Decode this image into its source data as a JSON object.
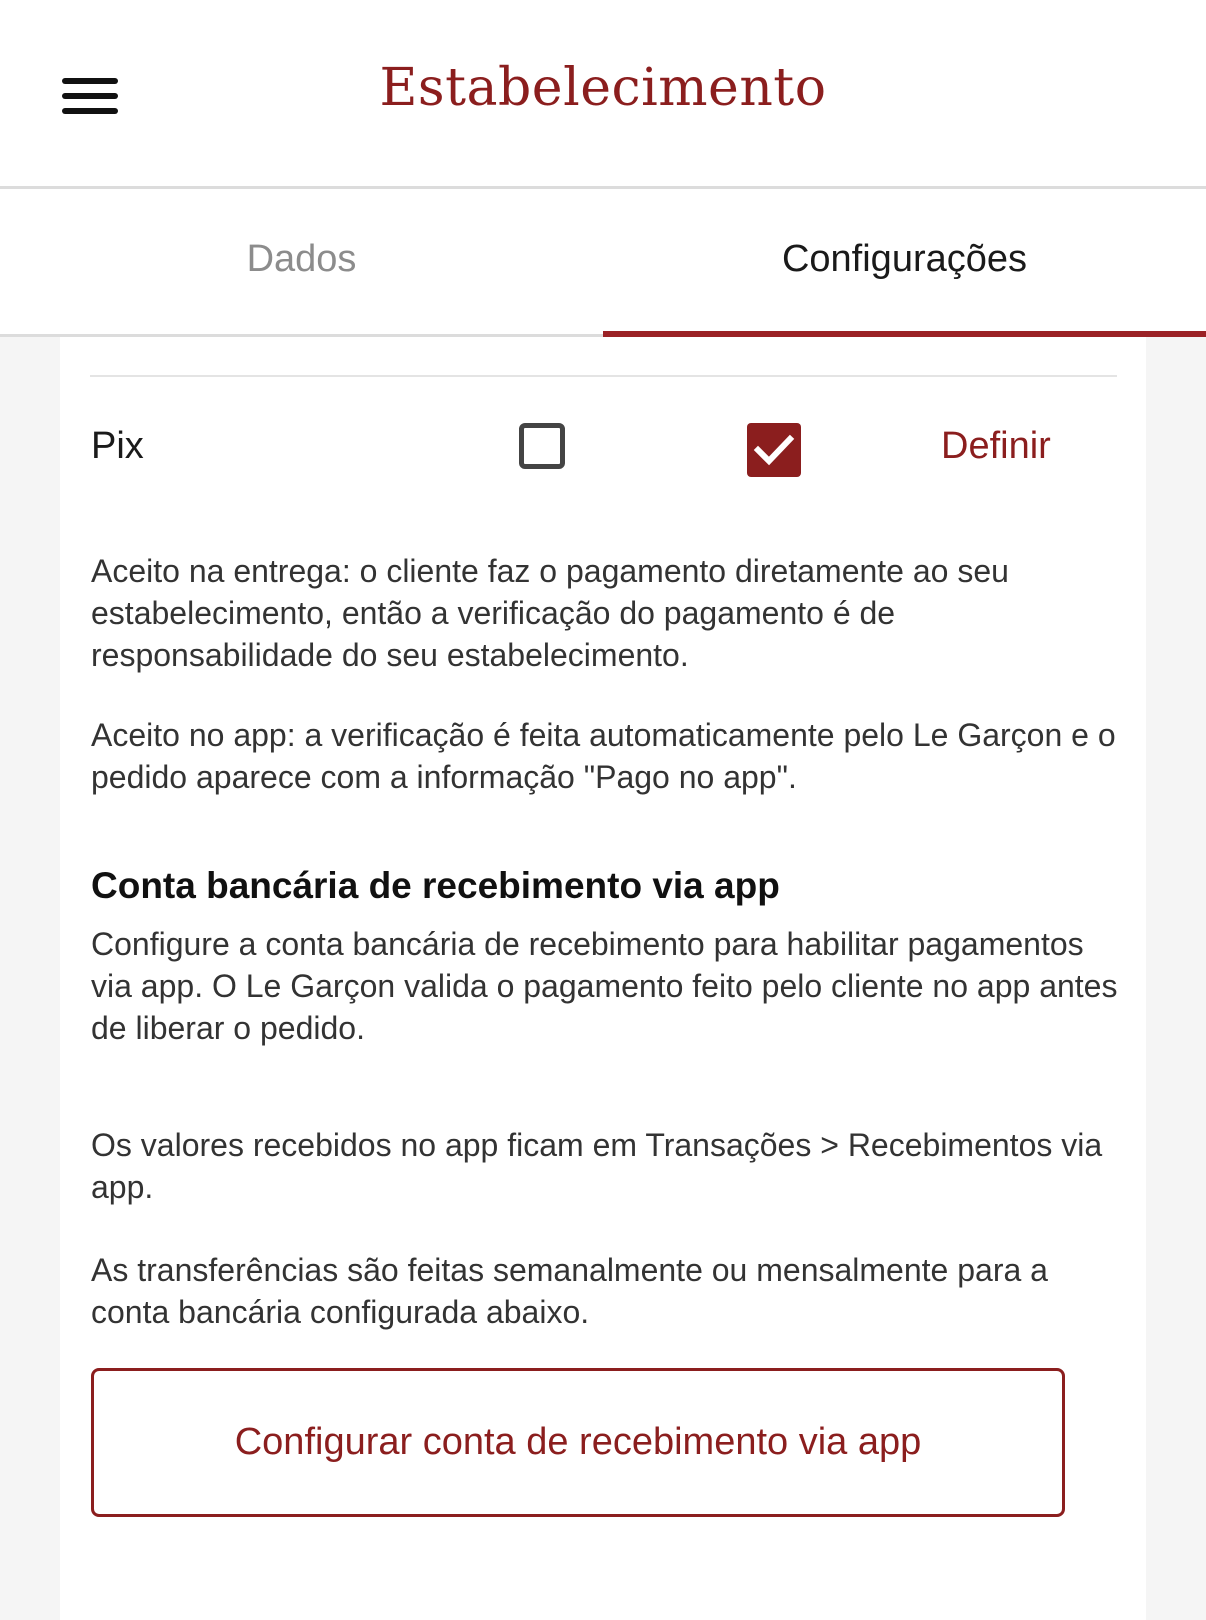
{
  "header": {
    "title": "Estabelecimento",
    "menu_icon": "hamburger-menu-icon"
  },
  "tabs": [
    {
      "label": "Dados",
      "active": false
    },
    {
      "label": "Configurações",
      "active": true
    }
  ],
  "payment_row": {
    "label": "Pix",
    "accept_on_delivery_checked": false,
    "accept_in_app_checked": true,
    "action_label": "Definir"
  },
  "descriptions": {
    "delivery": "Aceito na entrega: o cliente faz o pagamento diretamente ao seu estabelecimento, então a verificação do pagamento é de responsabilidade do seu estabelecimento.",
    "app": "Aceito no app: a verificação é feita automaticamente pelo Le Garçon e o pedido aparece com a informação \"Pago no app\"."
  },
  "bank_section": {
    "heading": "Conta bancária de recebimento via app",
    "paragraph1": "Configure a conta bancária de recebimento para habilitar pagamentos via app. O Le Garçon valida o pagamento feito pelo cliente no app antes de liberar o pedido.",
    "paragraph2": "Os valores recebidos no app ficam em Transações > Recebimentos via app.",
    "paragraph3": "As transferências são feitas semanalmente ou mensalmente para a conta bancária configurada abaixo.",
    "button_label": "Configurar conta de recebimento via app"
  },
  "colors": {
    "accent": "#8b1e1e",
    "inactive_tab": "#8c8c8c",
    "background": "#f5f5f5"
  }
}
